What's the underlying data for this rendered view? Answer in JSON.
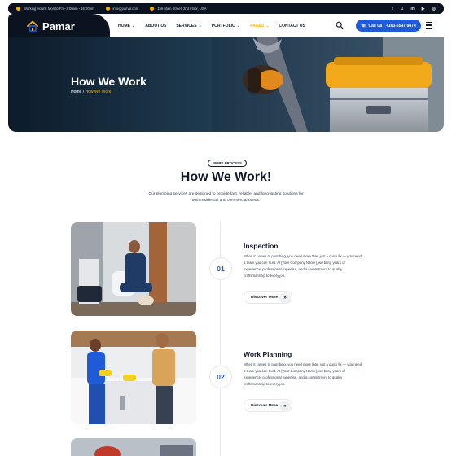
{
  "topbar": {
    "hours": "Working Hours: Mon to Fri - 8:00am - 16:00pm",
    "email": "info@pamar.com",
    "address": "156 Main Street, 2nd Floor, USA",
    "socials": [
      "f",
      "X",
      "in",
      "▶",
      "◎"
    ]
  },
  "header": {
    "brand": "Pamar",
    "nav": [
      {
        "label": "HOME",
        "has_dropdown": true
      },
      {
        "label": "ABOUT US",
        "has_dropdown": false
      },
      {
        "label": "SERVICES",
        "has_dropdown": true
      },
      {
        "label": "PORTFOLIO",
        "has_dropdown": true
      },
      {
        "label": "PAGES",
        "has_dropdown": true,
        "active": true
      },
      {
        "label": "CONTACT US",
        "has_dropdown": false
      }
    ],
    "call_label": "Call Us : +163-6547-9874",
    "icons": [
      "search-icon",
      "phone-icon",
      "menu-icon"
    ]
  },
  "hero": {
    "title": "How We Work",
    "breadcrumb_home": "Home",
    "breadcrumb_sep": " / ",
    "breadcrumb_current": "How We Work"
  },
  "section": {
    "badge": "WORK PROCESS",
    "title": "How We Work!",
    "desc": "Our plumbing services are designed to provide fast, reliable, and long-lasting solutions for both residential and commercial needs."
  },
  "steps": [
    {
      "number": "01",
      "title": "Inspection",
      "text": "When it comes to plumbing, you need more than just a quick fix — you need a team you can trust. At [Your Company Name], we bring years of experience, professional expertise, and a commitment to quality craftsmanship to every job.",
      "button": "Discover More"
    },
    {
      "number": "02",
      "title": "Work Planning",
      "text": "When it comes to plumbing, you need more than just a quick fix — you need a team you can trust. At [Your Company Name], we bring years of experience, professional expertise, and a commitment to quality craftsmanship to every job.",
      "button": "Discover More"
    }
  ],
  "colors": {
    "accent": "#f5b400",
    "primary": "#1f5bd8",
    "dark": "#0b1220"
  }
}
